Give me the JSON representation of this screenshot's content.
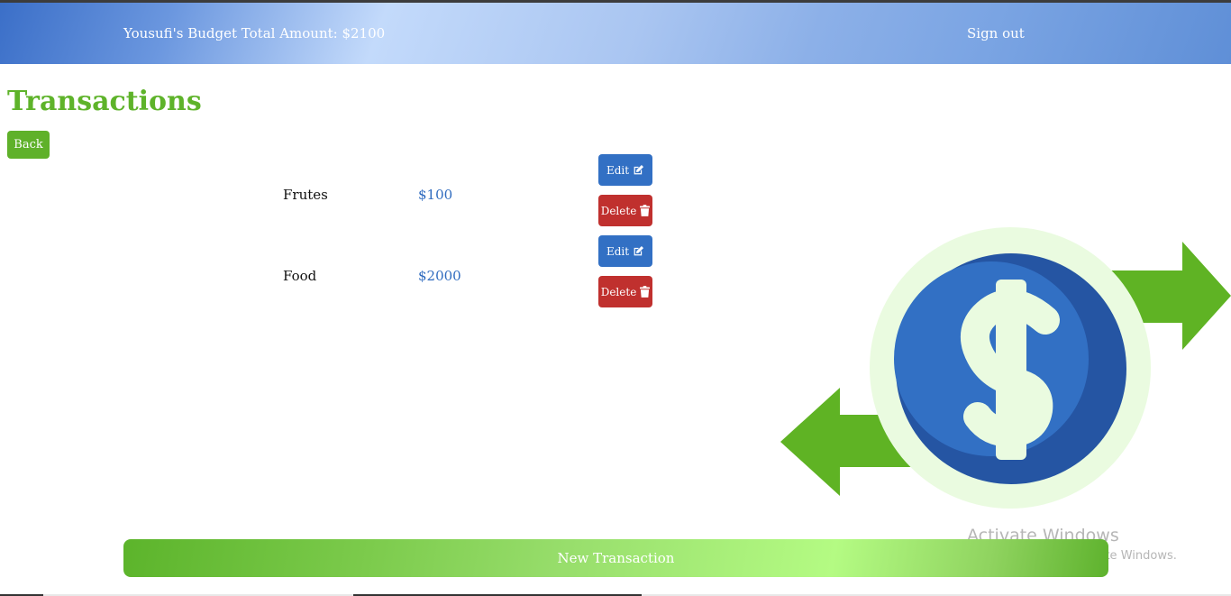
{
  "header": {
    "budget_title": "Yousufi's Budget Total Amount: $2100",
    "signout_label": "Sign out"
  },
  "page": {
    "title": "Transactions",
    "back_label": "Back"
  },
  "transactions": [
    {
      "name": "Frutes",
      "amount": "$100",
      "edit_label": "Edit",
      "delete_label": "Delete"
    },
    {
      "name": "Food",
      "amount": "$2000",
      "edit_label": "Edit",
      "delete_label": "Delete"
    }
  ],
  "footer": {
    "new_transaction_label": "New Transaction"
  },
  "watermark": {
    "title": "Activate Windows",
    "subtitle": "Go to Settings to activate Windows."
  },
  "icons": {
    "edit": "pen-to-square-icon",
    "delete": "trash-icon",
    "illustration": "dollar-exchange-icon"
  },
  "colors": {
    "brand_green": "#5eb32a",
    "accent_blue": "#3270c4",
    "danger_red": "#c0302e",
    "amount_blue": "#2f6bbf"
  }
}
